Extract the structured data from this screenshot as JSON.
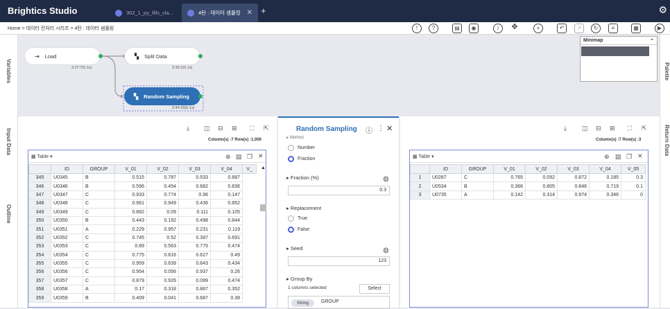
{
  "app": {
    "title": "Brightics Studio"
  },
  "tabs": [
    {
      "label": "302_1_py_fills_cla..."
    },
    {
      "label": "4탄 : 데이터 샘플링"
    }
  ],
  "tab_add": "+",
  "settings_icon": "gear-icon",
  "breadcrumb": "Home > 데이터 전처리 시리즈 > 4탄 : 데이터 샘플링",
  "toolbar_icons": [
    "info-icon",
    "help-icon",
    "film-icon",
    "camera-icon",
    "clock-icon",
    "move-icon",
    "zoom-icon",
    "undo-icon",
    "export-icon",
    "refresh-icon",
    "clipboard-icon",
    "calendar-icon",
    "play-icon"
  ],
  "sidebar_left": {
    "variables": "Variables",
    "input_data": "Input Data",
    "outline": "Outline"
  },
  "sidebar_right": {
    "palette": "Palette",
    "return_data": "Return Data"
  },
  "nodes": {
    "load": {
      "label": "Load",
      "time": "3:27:7(0.1s)"
    },
    "split": {
      "label": "Split Data",
      "time": "3:30:1(0.1s)"
    },
    "random": {
      "label": "Random Sampling",
      "time": "3:44:29(0.1s)"
    }
  },
  "minimap": {
    "title": "Minimap"
  },
  "left_panel": {
    "counts": "Column(s) :7   Row(s) :1,000",
    "table_label": "Table",
    "columns": [
      "",
      "ID",
      "GROUP",
      "V_01",
      "V_02",
      "V_03",
      "V_04",
      "V_"
    ],
    "rows": [
      [
        "345",
        "U0345",
        "B",
        "0.515",
        "0.787",
        "0.533",
        "0.887"
      ],
      [
        "346",
        "U0346",
        "B",
        "0.596",
        "0.454",
        "0.682",
        "0.836"
      ],
      [
        "347",
        "U0347",
        "C",
        "0.933",
        "0.774",
        "0.96",
        "0.147"
      ],
      [
        "348",
        "U0348",
        "C",
        "0.961",
        "0.949",
        "0.436",
        "0.852"
      ],
      [
        "349",
        "U0349",
        "C",
        "0.882",
        "0.09",
        "0.111",
        "0.105"
      ],
      [
        "350",
        "U0350",
        "B",
        "0.443",
        "0.192",
        "0.498",
        "0.844"
      ],
      [
        "351",
        "U0351",
        "A",
        "0.229",
        "0.957",
        "0.231",
        "0.119"
      ],
      [
        "352",
        "U0352",
        "C",
        "0.745",
        "0.52",
        "0.397",
        "0.691"
      ],
      [
        "353",
        "U0353",
        "C",
        "0.89",
        "0.563",
        "0.775",
        "0.474"
      ],
      [
        "354",
        "U0354",
        "C",
        "0.775",
        "0.816",
        "0.627",
        "0.49"
      ],
      [
        "355",
        "U0355",
        "C",
        "0.959",
        "0.639",
        "0.643",
        "0.434"
      ],
      [
        "356",
        "U0356",
        "C",
        "0.954",
        "0.056",
        "0.937",
        "0.26"
      ],
      [
        "357",
        "U0357",
        "C",
        "0.879",
        "0.926",
        "0.099",
        "0.474"
      ],
      [
        "358",
        "U0358",
        "A",
        "0.17",
        "0.318",
        "0.887",
        "0.352"
      ],
      [
        "359",
        "U0359",
        "B",
        "0.409",
        "0.041",
        "0.687",
        "0.38"
      ]
    ]
  },
  "right_panel": {
    "counts": "Column(s) :7   Row(s) :3",
    "table_label": "Table",
    "columns": [
      "",
      "ID",
      "GROUP",
      "V_01",
      "V_02",
      "V_03",
      "V_04",
      "V_05"
    ],
    "rows": [
      [
        "1",
        "U0287",
        "C",
        "0.765",
        "0.092",
        "0.872",
        "0.185",
        "0.3"
      ],
      [
        "2",
        "U0534",
        "B",
        "0.366",
        "0.805",
        "0.846",
        "0.719",
        "0.1"
      ],
      [
        "3",
        "U0735",
        "A",
        "0.142",
        "0.314",
        "0.974",
        "0.346",
        "0"
      ]
    ]
  },
  "properties": {
    "title": "Random Sampling",
    "method_label": "Method",
    "method_options": [
      "Number",
      "Fraction"
    ],
    "fraction_label": "Fraction (%)",
    "fraction_value": "0.3",
    "replacement_label": "Replacement",
    "replacement_options": [
      "True",
      "False"
    ],
    "seed_label": "Seed",
    "seed_value": "123",
    "groupby_label": "Group By",
    "groupby_selected": "1 columns selected",
    "select_btn": "Select",
    "chip_type": "String",
    "chip_value": "GROUP"
  }
}
